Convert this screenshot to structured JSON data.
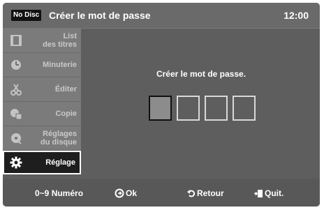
{
  "header": {
    "badge": "No Disc",
    "title": "Créer le mot de passe",
    "clock": "12:00"
  },
  "sidebar": {
    "items": [
      {
        "label": "List\ndes titres",
        "icon": "film-icon"
      },
      {
        "label": "Minuterie",
        "icon": "timer-icon"
      },
      {
        "label": "Éditer",
        "icon": "scissors-icon"
      },
      {
        "label": "Copie",
        "icon": "copy-icon"
      },
      {
        "label": "Réglages\ndu disque",
        "icon": "disc-settings-icon"
      },
      {
        "label": "Réglage",
        "icon": "gear-icon"
      }
    ],
    "active_index": 5
  },
  "main": {
    "prompt": "Créer le mot de passe.",
    "pin_boxes": 4,
    "pin_current_index": 0
  },
  "footer": {
    "number": "0~9 Numéro",
    "ok": "Ok",
    "back": "Retour",
    "quit": "Quit."
  },
  "colors": {
    "background": "#5e5e5e",
    "active_item": "#1e1e1e",
    "text": "#ffffff"
  }
}
